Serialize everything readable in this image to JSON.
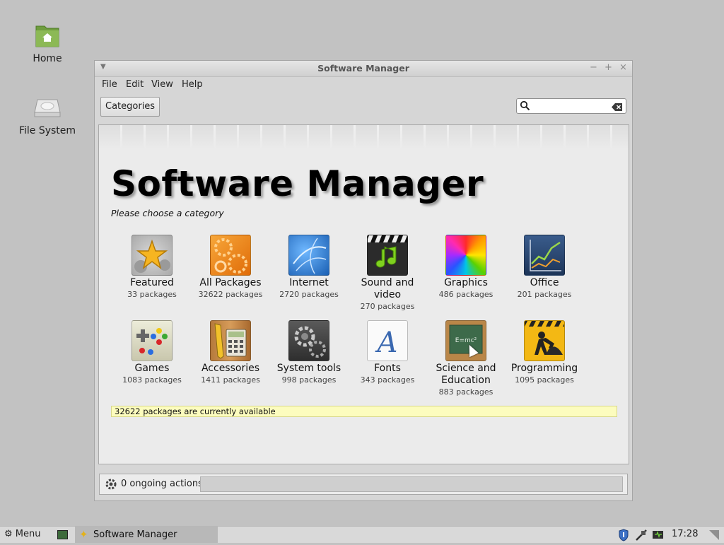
{
  "desktop": {
    "icons": [
      {
        "label": "Home",
        "icon": "home-folder-icon"
      },
      {
        "label": "File System",
        "icon": "drive-icon"
      }
    ]
  },
  "window": {
    "title": "Software Manager",
    "menu": [
      "File",
      "Edit",
      "View",
      "Help"
    ],
    "categories_button": "Categories",
    "search": {
      "value": "",
      "placeholder": ""
    },
    "heading": "Software Manager",
    "subheading": "Please choose a category",
    "categories": [
      {
        "name": "Featured",
        "count": "33 packages",
        "icon": "star-icon"
      },
      {
        "name": "All Packages",
        "count": "32622 packages",
        "icon": "gears-icon"
      },
      {
        "name": "Internet",
        "count": "2720 packages",
        "icon": "globe-icon"
      },
      {
        "name": "Sound and video",
        "count": "270 packages",
        "icon": "clapperboard-music-icon"
      },
      {
        "name": "Graphics",
        "count": "486 packages",
        "icon": "color-wheel-icon"
      },
      {
        "name": "Office",
        "count": "201 packages",
        "icon": "chart-icon"
      },
      {
        "name": "Games",
        "count": "1083 packages",
        "icon": "gamepad-icon"
      },
      {
        "name": "Accessories",
        "count": "1411 packages",
        "icon": "calculator-icon"
      },
      {
        "name": "System tools",
        "count": "998 packages",
        "icon": "gear-icon"
      },
      {
        "name": "Fonts",
        "count": "343 packages",
        "icon": "font-icon"
      },
      {
        "name": "Science and Education",
        "count": "883 packages",
        "icon": "chalkboard-icon"
      },
      {
        "name": "Programming",
        "count": "1095 packages",
        "icon": "construction-icon"
      }
    ],
    "status_message": "32622 packages are currently available",
    "ongoing_actions": "0 ongoing actions"
  },
  "taskbar": {
    "menu_label": "Menu",
    "task_label": "Software Manager",
    "clock": "17:28"
  }
}
